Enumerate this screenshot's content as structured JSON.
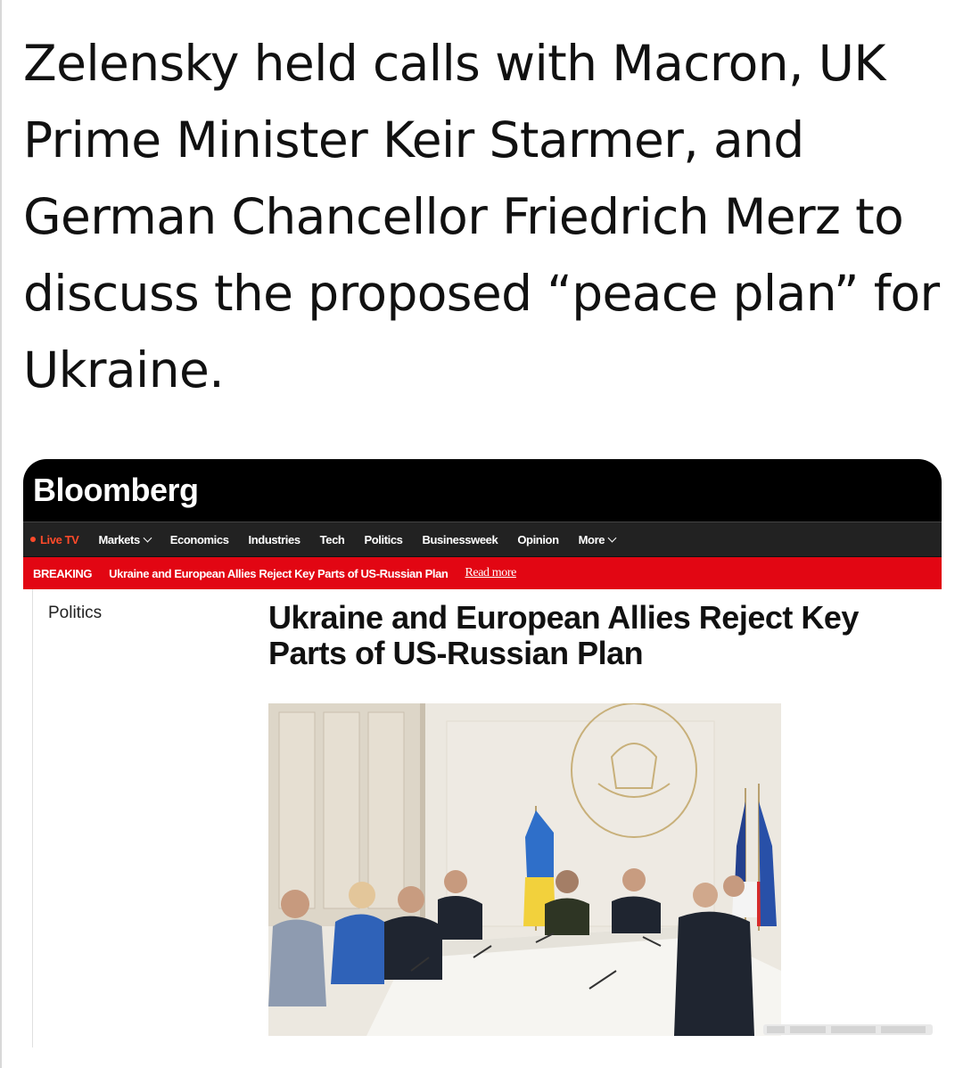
{
  "tweet": {
    "text": "Zelensky held calls with Macron, UK Prime Minister Keir Starmer, and German Chancellor Friedrich Merz to discuss the proposed “peace plan” for Ukraine."
  },
  "bloomberg": {
    "logo": "Bloomberg",
    "nav": {
      "live_tv": "Live TV",
      "items": [
        "Markets",
        "Economics",
        "Industries",
        "Tech",
        "Politics",
        "Businessweek",
        "Opinion",
        "More"
      ]
    },
    "breaking": {
      "label": "BREAKING",
      "headline": "Ukraine and European Allies Reject Key Parts of US-Russian Plan",
      "link": "Read more"
    },
    "article": {
      "section": "Politics",
      "headline": "Ukraine and European Allies Reject Key Parts of US-Russian Plan"
    },
    "colors": {
      "masthead": "#000000",
      "navbar": "#222222",
      "breaking": "#e20613",
      "live_tv": "#ff4a2a"
    }
  }
}
